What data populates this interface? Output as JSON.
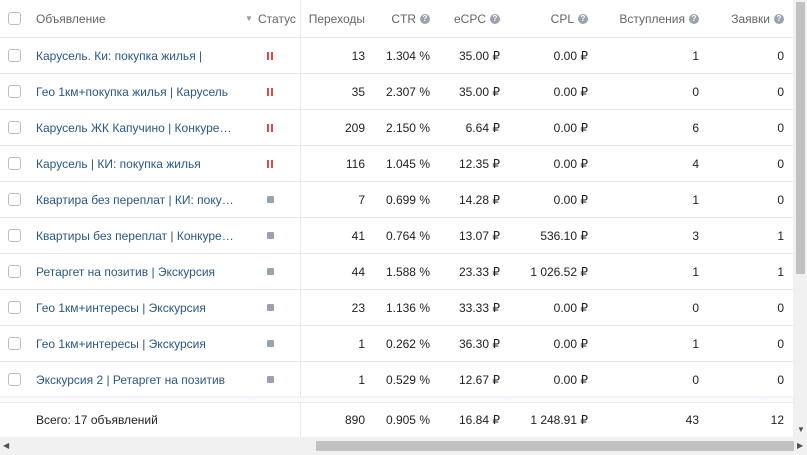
{
  "columns": {
    "ad": "Объявление",
    "status": "Статус",
    "clicks": "Переходы",
    "ctr": "CTR",
    "ecpc": "eCPC",
    "cpl": "CPL",
    "joins": "Вступления",
    "requests": "Заявки"
  },
  "rows": [
    {
      "name": "Карусель. Ки: покупка жилья |",
      "status": "paused",
      "clicks": "13",
      "ctr": "1.304 %",
      "ecpc": "35.00 ₽",
      "cpl": "0.00 ₽",
      "joins": "1",
      "requests": "0"
    },
    {
      "name": "Гео 1км+покупка жилья | Карусель",
      "status": "paused",
      "clicks": "35",
      "ctr": "2.307 %",
      "ecpc": "35.00 ₽",
      "cpl": "0.00 ₽",
      "joins": "0",
      "requests": "0"
    },
    {
      "name": "Карусель ЖК Капучино | Конкуренты",
      "status": "paused",
      "clicks": "209",
      "ctr": "2.150 %",
      "ecpc": "6.64 ₽",
      "cpl": "0.00 ₽",
      "joins": "6",
      "requests": "0"
    },
    {
      "name": "Карусель | КИ: покупка жилья",
      "status": "paused",
      "clicks": "116",
      "ctr": "1.045 %",
      "ecpc": "12.35 ₽",
      "cpl": "0.00 ₽",
      "joins": "4",
      "requests": "0"
    },
    {
      "name": "Квартира без переплат | КИ: покупк...",
      "status": "stopped",
      "clicks": "7",
      "ctr": "0.699 %",
      "ecpc": "14.28 ₽",
      "cpl": "0.00 ₽",
      "joins": "1",
      "requests": "0"
    },
    {
      "name": "Квартиры без переплат | Конкуренты",
      "status": "stopped",
      "clicks": "41",
      "ctr": "0.764 %",
      "ecpc": "13.07 ₽",
      "cpl": "536.10 ₽",
      "joins": "3",
      "requests": "1"
    },
    {
      "name": "Ретаргет на позитив | Экскурсия",
      "status": "stopped",
      "clicks": "44",
      "ctr": "1.588 %",
      "ecpc": "23.33 ₽",
      "cpl": "1 026.52 ₽",
      "joins": "1",
      "requests": "1"
    },
    {
      "name": "Гео 1км+интересы | Экскурсия",
      "status": "stopped",
      "clicks": "23",
      "ctr": "1.136 %",
      "ecpc": "33.33 ₽",
      "cpl": "0.00 ₽",
      "joins": "0",
      "requests": "0"
    },
    {
      "name": "Гео 1км+интересы | Экскурсия",
      "status": "stopped",
      "clicks": "1",
      "ctr": "0.262 %",
      "ecpc": "36.30 ₽",
      "cpl": "0.00 ₽",
      "joins": "1",
      "requests": "0"
    },
    {
      "name": "Экскурсия 2 | Ретаргет на позитив",
      "status": "stopped",
      "clicks": "1",
      "ctr": "0.529 %",
      "ecpc": "12.67 ₽",
      "cpl": "0.00 ₽",
      "joins": "0",
      "requests": "0"
    }
  ],
  "total": {
    "label": "Всего: 17 объявлений",
    "clicks": "890",
    "ctr": "0.905 %",
    "ecpc": "16.84 ₽",
    "cpl": "1 248.91 ₽",
    "joins": "43",
    "requests": "12"
  },
  "icons": {
    "help": "?",
    "sort": "▼",
    "scroll_left": "◀",
    "scroll_right": "▶",
    "scroll_up": "▲",
    "scroll_down": "▼"
  },
  "colors": {
    "link": "#2a5885",
    "paused": "#e64646",
    "stopped": "#99a2ad"
  }
}
